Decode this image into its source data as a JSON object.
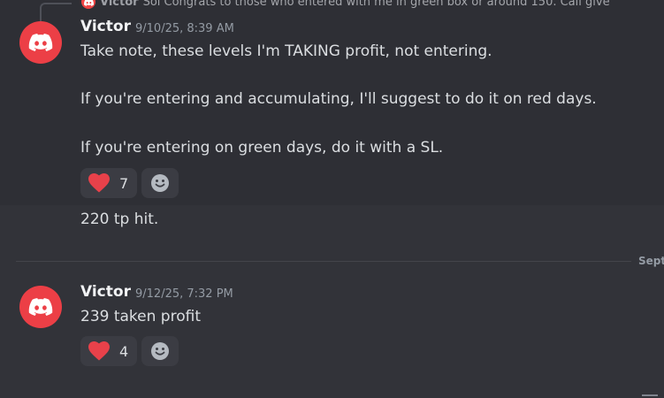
{
  "reply": {
    "author": "Victor",
    "preview": "Sol Congrats to those who entered with me in green box or around 150. Call give"
  },
  "messages": [
    {
      "author": "Victor",
      "timestamp": "9/10/25, 8:39 AM",
      "lines": [
        "Take note, these levels I'm TAKING profit, not entering.",
        "If you're entering and accumulating, I'll suggest to do it on red days.",
        "If you're entering on green days, do it with a SL."
      ],
      "reaction": {
        "emoji": "heart-icon",
        "count": "7"
      }
    },
    {
      "text": "220 tp hit."
    },
    {
      "author": "Victor",
      "timestamp": "9/12/25, 7:32 PM",
      "lines": [
        "239 taken profit"
      ],
      "reaction": {
        "emoji": "heart-icon",
        "count": "4"
      }
    }
  ],
  "divider": {
    "label": "Sept"
  },
  "colors": {
    "background": "#323339",
    "avatar": "#ec3f46",
    "heart": "#e8414a",
    "reaction_bg": "#3b3c43"
  }
}
